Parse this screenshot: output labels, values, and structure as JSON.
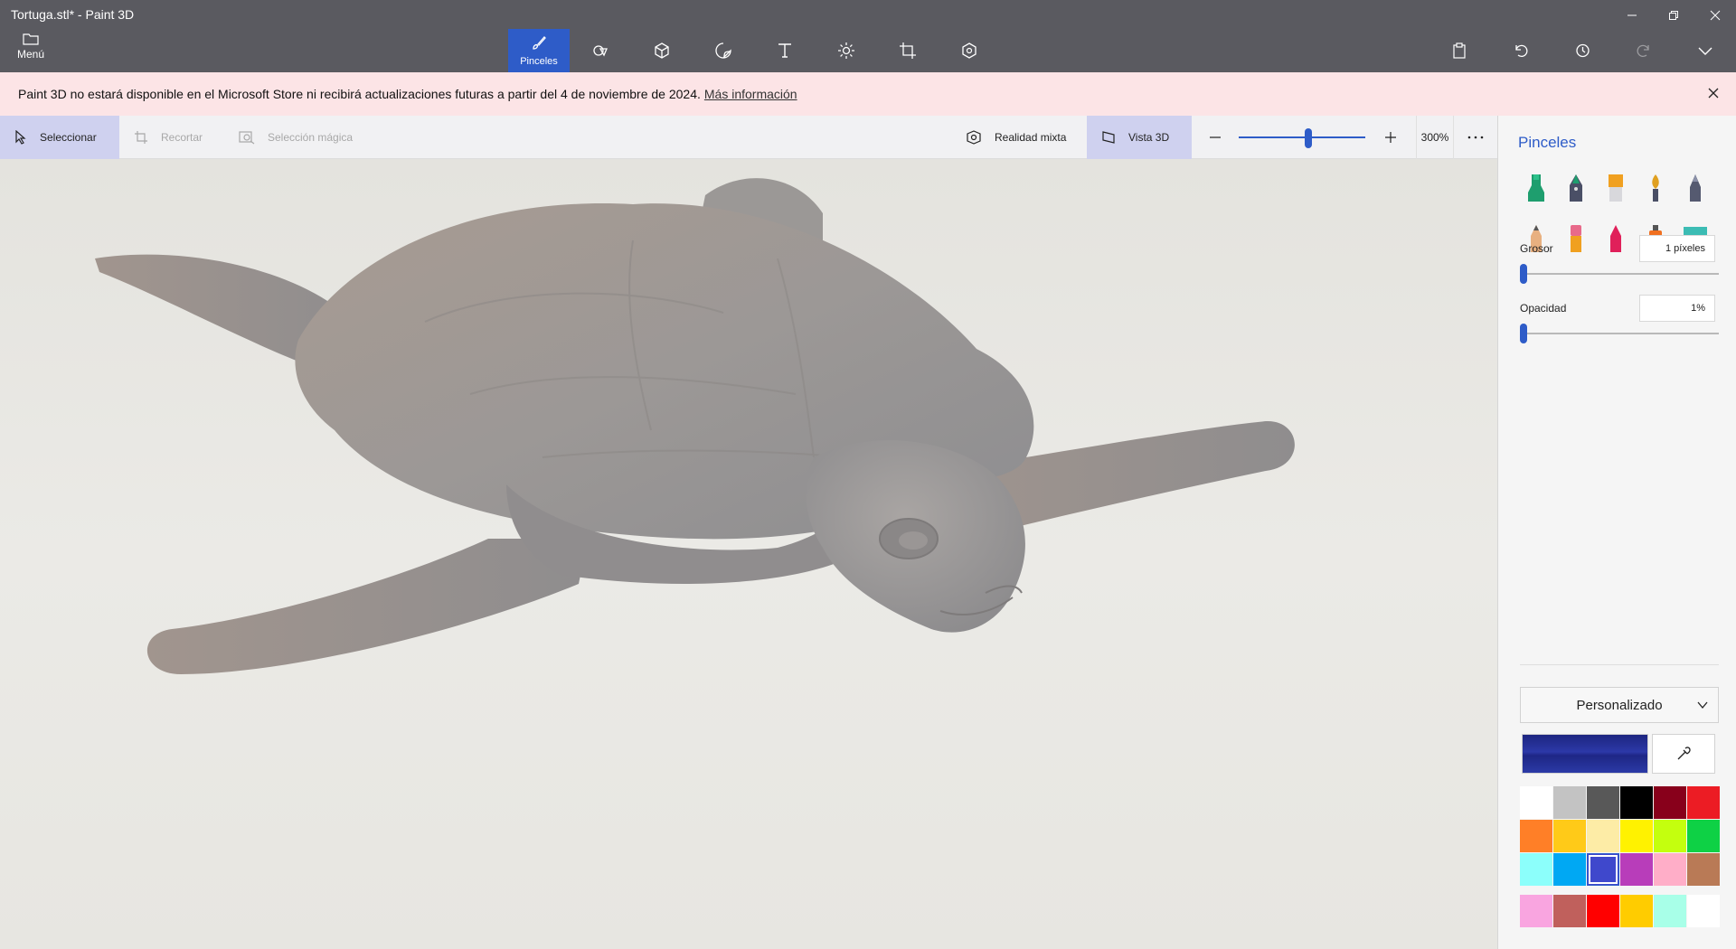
{
  "window": {
    "title": "Tortuga.stl* - Paint 3D"
  },
  "menu": {
    "label": "Menú"
  },
  "toolbar": {
    "tools": [
      {
        "name": "brushes",
        "label": "Pinceles",
        "icon": "brush-icon",
        "active": true
      },
      {
        "name": "2d-shapes",
        "label": "",
        "icon": "2d-shapes-icon"
      },
      {
        "name": "3d-shapes",
        "label": "",
        "icon": "3d-shapes-icon"
      },
      {
        "name": "stickers",
        "label": "",
        "icon": "stickers-icon"
      },
      {
        "name": "text",
        "label": "",
        "icon": "text-icon"
      },
      {
        "name": "effects",
        "label": "",
        "icon": "effects-icon"
      },
      {
        "name": "canvas",
        "label": "",
        "icon": "canvas-icon"
      },
      {
        "name": "3d-library",
        "label": "",
        "icon": "3d-library-icon"
      }
    ]
  },
  "banner": {
    "text": "Paint 3D no estará disponible en el Microsoft Store ni recibirá actualizaciones futuras a partir del 4 de noviembre de 2024.",
    "link": "Más información"
  },
  "subbar": {
    "select": "Seleccionar",
    "crop": "Recortar",
    "magic_select": "Selección mágica",
    "mixed_reality": "Realidad mixta",
    "view_3d": "Vista 3D",
    "zoom": "300%",
    "zoom_level": 0.55
  },
  "panel": {
    "title": "Pinceles",
    "brushes": [
      {
        "name": "marker-brush",
        "color": "#1e9e6e"
      },
      {
        "name": "calligraphy-pen-brush",
        "color": "#1e9e6e"
      },
      {
        "name": "oil-brush",
        "color": "#f0a020"
      },
      {
        "name": "watercolor-brush",
        "color": "#e0a020"
      },
      {
        "name": "pixel-pen-brush",
        "color": "#555a70"
      },
      {
        "name": "pencil-brush",
        "color": "#e8b080"
      },
      {
        "name": "eraser-brush",
        "color": "#e86a8a"
      },
      {
        "name": "crayon-brush",
        "color": "#e0205a"
      },
      {
        "name": "spraycan-brush",
        "color": "#f07020"
      },
      {
        "name": "fill-brush",
        "color": "#3cbcb4"
      }
    ],
    "thickness": {
      "label": "Grosor",
      "value": "1 píxeles",
      "level": 0.0
    },
    "opacity": {
      "label": "Opacidad",
      "value": "1%",
      "level": 0.0
    },
    "finish": "Personalizado",
    "current_color": "#2a35a0",
    "palette": [
      "#ffffff",
      "#c3c3c3",
      "#585858",
      "#000000",
      "#88001b",
      "#ec1c24",
      "#ff7f27",
      "#ffca18",
      "#fdeca6",
      "#fff200",
      "#c4ff0e",
      "#0ed145",
      "#8cfffb",
      "#00a8f3",
      "#3f48cc",
      "#b83dba",
      "#ffaec8",
      "#b97a56"
    ],
    "selected_swatch": 14,
    "custom_palette": [
      "#f9a5e0",
      "#c0605c",
      "#ff0000",
      "#ffcc00",
      "#a8ffe8",
      "#ffffff"
    ]
  },
  "colors": {
    "accent": "#2e5cc8",
    "ribbon": "#5a5a60",
    "banner_bg": "#fce4e6"
  }
}
